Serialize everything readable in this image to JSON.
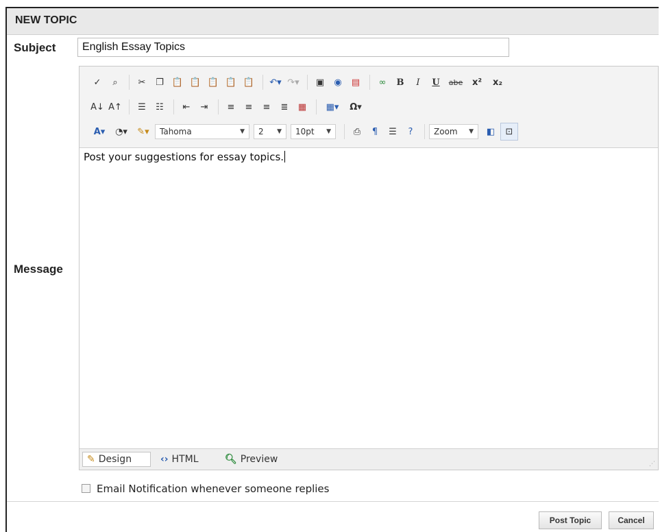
{
  "header": {
    "title": "NEW TOPIC"
  },
  "form": {
    "subject_label": "Subject",
    "subject_value": "English Essay Topics",
    "message_label": "Message"
  },
  "toolbar": {
    "font_family": "Tahoma",
    "font_size": "2",
    "font_size_pt": "10pt",
    "zoom": "Zoom",
    "bold": "B",
    "italic": "I",
    "underline": "U",
    "strike": "abe",
    "superscript": "x²",
    "subscript": "x₂",
    "special_char": "Ω"
  },
  "editor": {
    "content": "Post your suggestions for essay topics."
  },
  "modes": {
    "design": "Design",
    "html": "HTML",
    "preview": "Preview"
  },
  "notification": {
    "label": "Email Notification whenever someone replies"
  },
  "actions": {
    "post": "Post Topic",
    "cancel": "Cancel"
  }
}
